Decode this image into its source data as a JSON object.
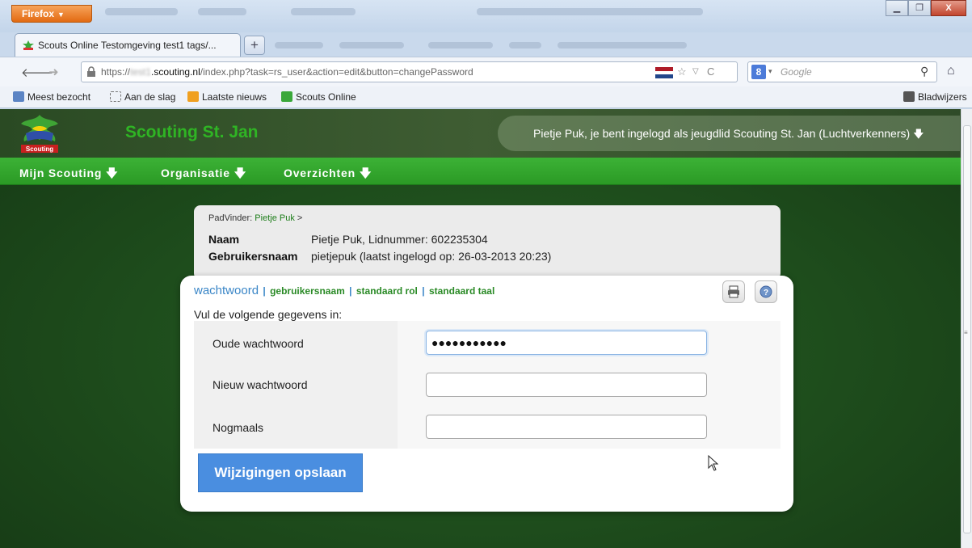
{
  "browser": {
    "menu_button": "Firefox",
    "tab_title": "Scouts Online Testomgeving test1 tags/...",
    "new_tab": "+",
    "url_prefix": "https://",
    "url_redacted": "test1",
    "url_domain": "scouting.nl",
    "url_path": "/index.php?task=rs_user&action=edit&button=changePassword",
    "search_placeholder": "Google",
    "search_engine_icon": "8",
    "bookmarks": [
      {
        "label": "Meest bezocht"
      },
      {
        "label": "Aan de slag"
      },
      {
        "label": "Laatste nieuws"
      },
      {
        "label": "Scouts Online"
      }
    ],
    "bookmarks_menu": "Bladwijzers"
  },
  "site": {
    "logo_text": "Scouting",
    "title": "Scouting St. Jan",
    "user_status": "Pietje Puk, je bent ingelogd als jeugdlid Scouting St. Jan (Luchtverkenners)",
    "menu": [
      {
        "label": "Mijn Scouting"
      },
      {
        "label": "Organisatie"
      },
      {
        "label": "Overzichten"
      }
    ]
  },
  "info": {
    "breadcrumb_prefix": "PadVinder:",
    "breadcrumb_link": "Pietje Puk",
    "breadcrumb_sep": ">",
    "name_label": "Naam",
    "name_value": "Pietje Puk,  Lidnummer: 602235304",
    "username_label": "Gebruikersnaam",
    "username_value": "pietjepuk  (laatst ingelogd op: 26-03-2013 20:23)"
  },
  "card": {
    "tabs": [
      {
        "label": "wachtwoord"
      },
      {
        "label": "gebruikersnaam"
      },
      {
        "label": "standaard rol"
      },
      {
        "label": "standaard taal"
      }
    ],
    "separator": "|",
    "intro": "Vul de volgende gegevens in:",
    "fields": [
      {
        "label": "Oude wachtwoord",
        "value": "●●●●●●●●●●●"
      },
      {
        "label": "Nieuw wachtwoord",
        "value": ""
      },
      {
        "label": "Nogmaals",
        "value": ""
      }
    ],
    "save_button": "Wijzigingen opslaan"
  },
  "colors": {
    "menu_green": "#2fa329",
    "title_green": "#2fb424",
    "tab_blue": "#3a86c7",
    "button_blue": "#4a8ee0"
  }
}
